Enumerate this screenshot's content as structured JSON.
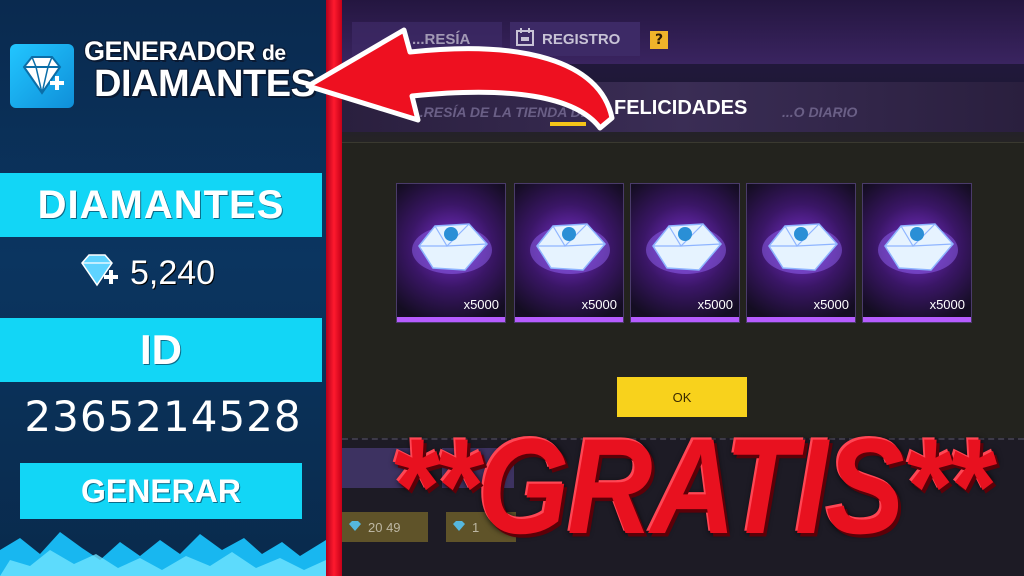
{
  "brand": {
    "line1_main": "GENERADOR",
    "line1_small": "de",
    "line2": "DIAMANTES"
  },
  "panel": {
    "diamonds_label": "DIAMANTES",
    "diamonds_value": "5,240",
    "id_label": "ID",
    "id_value": "2365214528",
    "generate_label": "GENERAR"
  },
  "game": {
    "tabs": [
      {
        "label": "...RESÍA"
      },
      {
        "label": "REGISTRO"
      }
    ],
    "help_label": "?",
    "banner_left_faded": "...RESÍA DE LA TIENDA DE",
    "banner_title": "FELICIDADES",
    "banner_right_faded": "...O DIARIO",
    "rewards": [
      {
        "qty": "x5000"
      },
      {
        "qty": "x5000"
      },
      {
        "qty": "x5000"
      },
      {
        "qty": "x5000"
      },
      {
        "qty": "x5000"
      }
    ],
    "ok_label": "OK",
    "currency_chips": [
      {
        "value": "20 49"
      },
      {
        "value": "1"
      }
    ]
  },
  "overlay": {
    "gratis_text": "**GRATIS**"
  },
  "colors": {
    "panel_cyan": "#12d6f6",
    "divider_red": "#ff1a2e",
    "ok_yellow": "#f8d21c",
    "gratis_red": "#e8111f"
  },
  "icons": {
    "logo": "diamond-plus-icon",
    "balance": "diamond-plus-icon",
    "registro": "calendar-icon",
    "reward": "diamond-gem-icon"
  }
}
